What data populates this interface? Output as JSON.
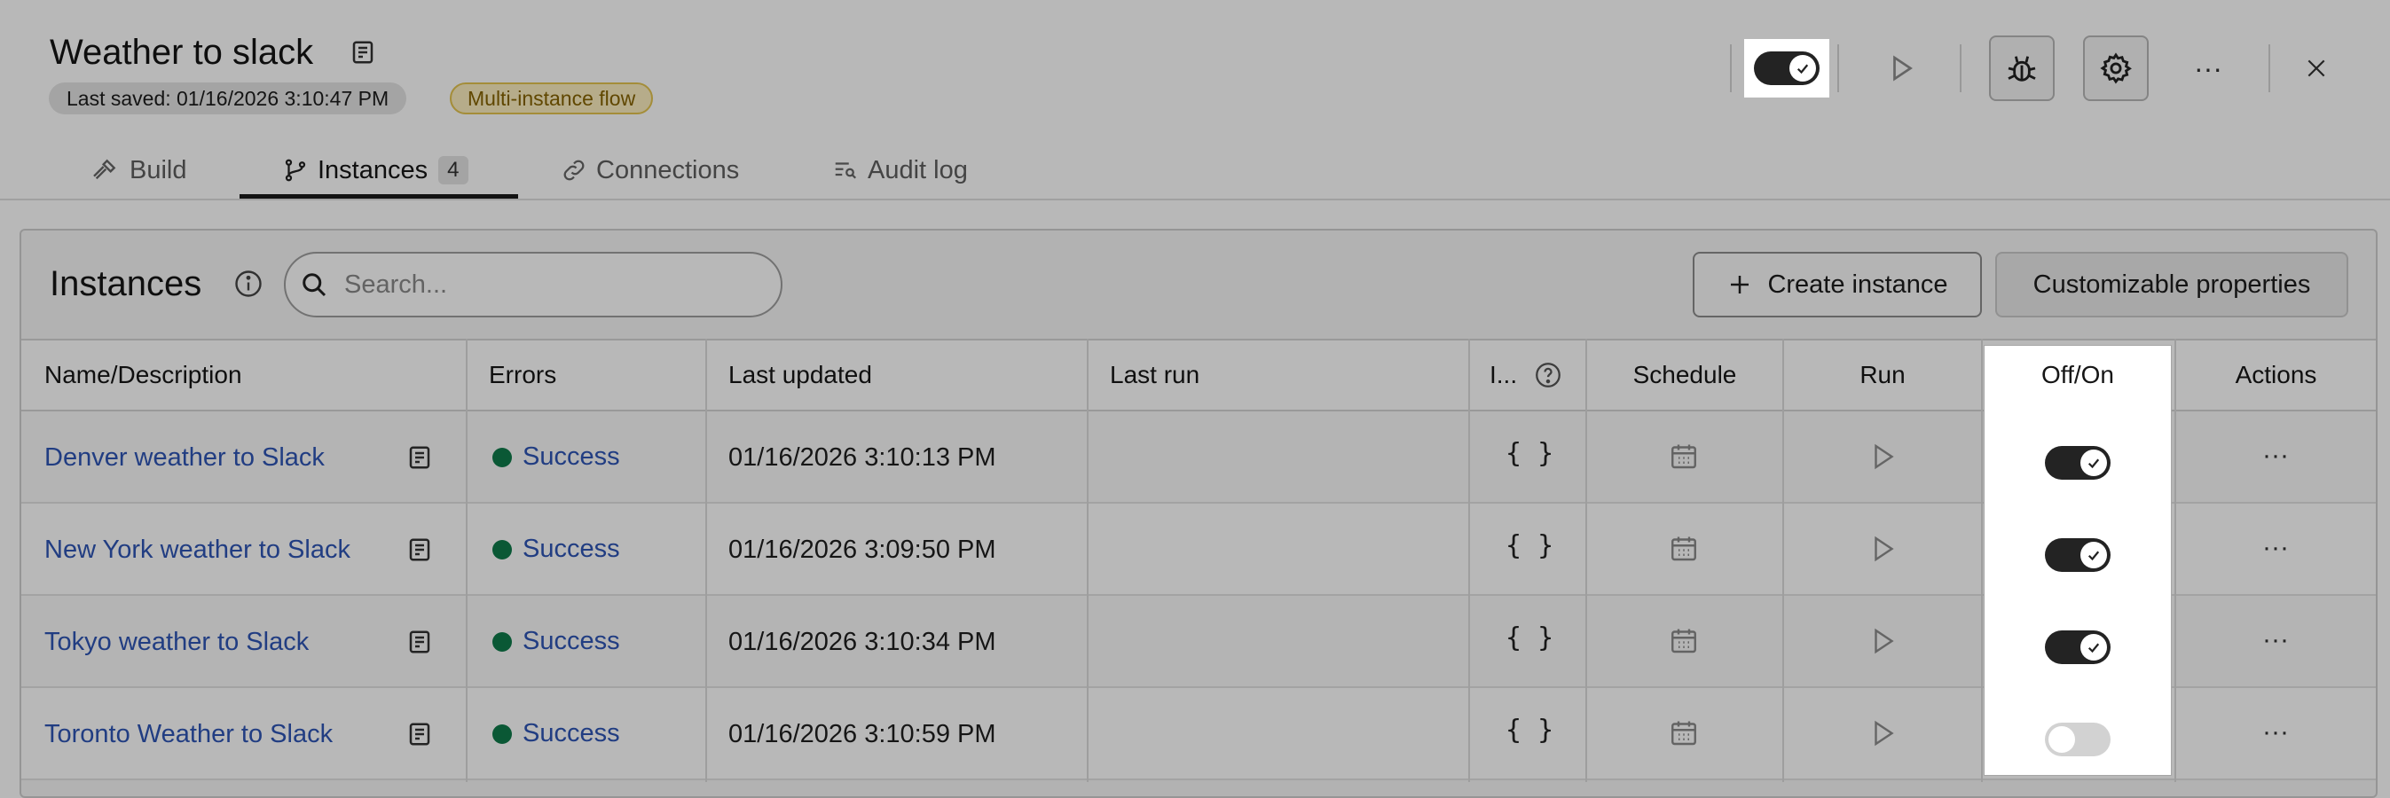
{
  "flow": {
    "title": "Weather to slack",
    "last_saved": "Last saved: 01/16/2026 3:10:47 PM",
    "badge": "Multi-instance flow",
    "enabled": true
  },
  "header_actions": [
    {
      "name": "run-icon"
    },
    {
      "name": "debug-icon"
    },
    {
      "name": "gear-icon"
    },
    {
      "name": "more-icon"
    },
    {
      "name": "close-icon"
    }
  ],
  "tabs": [
    {
      "label": "Build",
      "icon": "hammer-icon",
      "active": false
    },
    {
      "label": "Instances",
      "icon": "branch-icon",
      "count": "4",
      "active": true
    },
    {
      "label": "Connections",
      "icon": "link-icon",
      "active": false
    },
    {
      "label": "Audit log",
      "icon": "log-icon",
      "active": false
    }
  ],
  "instances": {
    "title": "Instances",
    "search_placeholder": "Search...",
    "create_label": "Create instance",
    "customizable_label": "Customizable properties",
    "columns": {
      "name": "Name/Description",
      "errors": "Errors",
      "last_updated": "Last updated",
      "last_run": "Last run",
      "inputs": "I...",
      "schedule": "Schedule",
      "run": "Run",
      "toggle": "Off/On",
      "actions": "Actions"
    },
    "rows": [
      {
        "name": "Denver weather to Slack",
        "status": "Success",
        "updated": "01/16/2026 3:10:13 PM",
        "last_run": "",
        "inputs": "{ }",
        "enabled": true
      },
      {
        "name": "New York weather to Slack",
        "status": "Success",
        "updated": "01/16/2026 3:09:50 PM",
        "last_run": "",
        "inputs": "{ }",
        "enabled": true
      },
      {
        "name": "Tokyo weather to Slack",
        "status": "Success",
        "updated": "01/16/2026 3:10:34 PM",
        "last_run": "",
        "inputs": "{ }",
        "enabled": true
      },
      {
        "name": "Toronto Weather to Slack",
        "status": "Success",
        "updated": "01/16/2026 3:10:59 PM",
        "last_run": "",
        "inputs": "{ }",
        "enabled": false
      }
    ],
    "more_glyph": "···"
  },
  "colors": {
    "link": "#2e55b5",
    "success_dot": "#0f7a4a",
    "badge_bg": "#fcefc0",
    "badge_text": "#866300",
    "overlay": "rgba(0,0,0,0.28)"
  }
}
